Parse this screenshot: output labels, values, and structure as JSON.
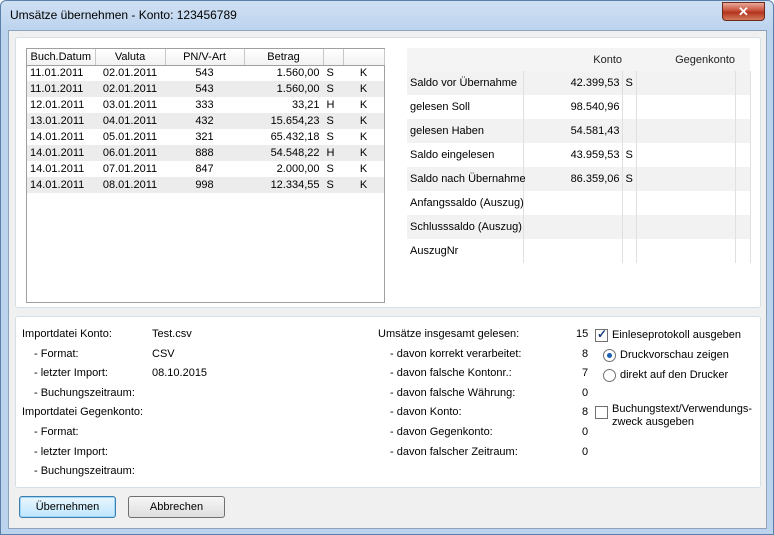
{
  "window": {
    "title": "Umsätze übernehmen - Konto: 123456789",
    "close_glyph": "✕"
  },
  "transactions": {
    "columns": [
      "Buch.Datum",
      "Valuta",
      "PN/V-Art",
      "Betrag",
      "",
      ""
    ],
    "rows": [
      [
        "11.01.2011",
        "02.01.2011",
        "543",
        "1.560,00",
        "S",
        "K"
      ],
      [
        "11.01.2011",
        "02.01.2011",
        "543",
        "1.560,00",
        "S",
        "K"
      ],
      [
        "12.01.2011",
        "03.01.2011",
        "333",
        "33,21",
        "H",
        "K"
      ],
      [
        "13.01.2011",
        "04.01.2011",
        "432",
        "15.654,23",
        "S",
        "K"
      ],
      [
        "14.01.2011",
        "05.01.2011",
        "321",
        "65.432,18",
        "S",
        "K"
      ],
      [
        "14.01.2011",
        "06.01.2011",
        "888",
        "54.548,22",
        "H",
        "K"
      ],
      [
        "14.01.2011",
        "07.01.2011",
        "847",
        "2.000,00",
        "S",
        "K"
      ],
      [
        "14.01.2011",
        "08.01.2011",
        "998",
        "12.334,55",
        "S",
        "K"
      ]
    ]
  },
  "balances": {
    "columns": [
      "",
      "Konto",
      "",
      "Gegenkonto",
      ""
    ],
    "rows": [
      {
        "label": "Saldo vor Übernahme",
        "konto": "42.399,53",
        "sh": "S"
      },
      {
        "label": "gelesen Soll",
        "konto": "98.540,96",
        "sh": ""
      },
      {
        "label": "gelesen Haben",
        "konto": "54.581,43",
        "sh": ""
      },
      {
        "label": "Saldo eingelesen",
        "konto": "43.959,53",
        "sh": "S"
      },
      {
        "label": "Saldo nach Übernahme",
        "konto": "86.359,06",
        "sh": "S"
      },
      {
        "label": "Anfangssaldo (Auszug)",
        "konto": "",
        "sh": ""
      },
      {
        "label": "Schlusssaldo (Auszug)",
        "konto": "",
        "sh": ""
      },
      {
        "label": "AuszugNr",
        "konto": "",
        "sh": ""
      }
    ]
  },
  "import_info": {
    "konto_label": "Importdatei Konto:",
    "konto_file": "Test.csv",
    "format_label": "- Format:",
    "format_value": "CSV",
    "last_import_label": "- letzter Import:",
    "last_import_value": "08.10.2015",
    "period_label": "- Buchungszeitraum:",
    "gegenkonto_label": "Importdatei Gegenkonto:",
    "g_format_label": "- Format:",
    "g_last_import_label": "- letzter Import:",
    "g_period_label": "- Buchungszeitraum:"
  },
  "stats": {
    "total_label": "Umsätze insgesamt gelesen:",
    "total_value": "15",
    "rows": [
      {
        "label": "- davon korrekt verarbeitet:",
        "value": "8"
      },
      {
        "label": "- davon falsche Kontonr.:",
        "value": "7"
      },
      {
        "label": "- davon falsche Währung:",
        "value": "0"
      },
      {
        "label": "- davon Konto:",
        "value": "8"
      },
      {
        "label": "- davon Gegenkonto:",
        "value": "0"
      },
      {
        "label": "- davon falscher Zeitraum:",
        "value": "0"
      }
    ]
  },
  "options": {
    "protocol_label": "Einleseprotokoll ausgeben",
    "protocol_checked": true,
    "preview_label": "Druckvorschau zeigen",
    "preview_selected": true,
    "printer_label": "direkt auf den Drucker",
    "printer_selected": false,
    "bookingtext_label_1": "Buchungstext/Verwendungs-",
    "bookingtext_label_2": "zweck ausgeben",
    "bookingtext_checked": false
  },
  "buttons": {
    "accept": "Übernehmen",
    "cancel": "Abbrechen"
  }
}
